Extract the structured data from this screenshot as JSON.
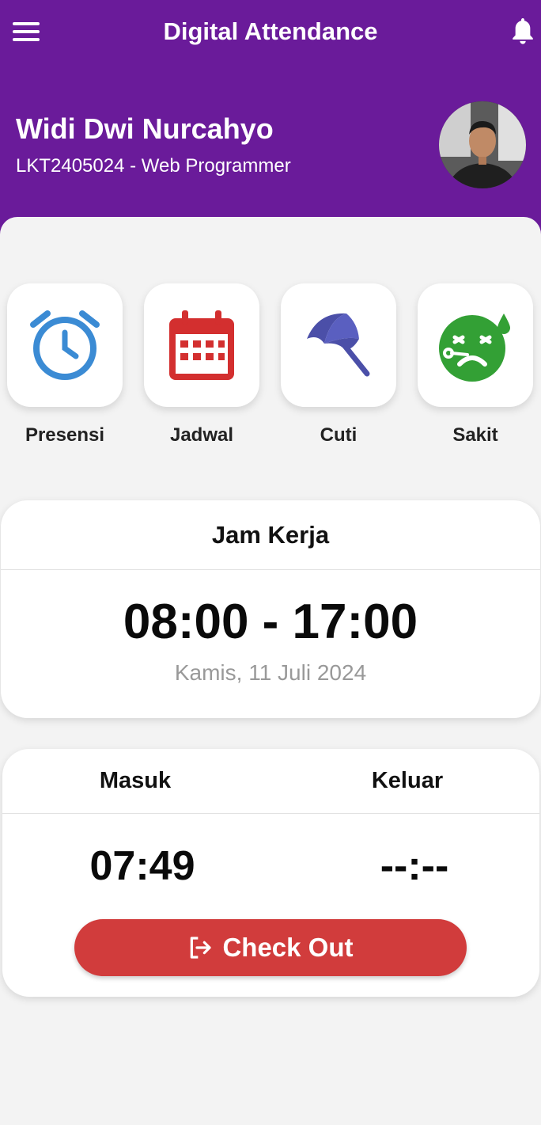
{
  "header": {
    "title": "Digital Attendance",
    "menu_icon": "hamburger-menu-icon",
    "notification_icon": "bell-icon",
    "background_color": "#6a1b9a"
  },
  "user": {
    "name": "Widi Dwi Nurcahyo",
    "subtitle": "LKT2405024 - Web Programmer"
  },
  "menu_tiles": [
    {
      "label": "Presensi",
      "icon": "alarm-clock-icon",
      "color": "#3b8bd4"
    },
    {
      "label": "Jadwal",
      "icon": "calendar-icon",
      "color": "#d32f2f"
    },
    {
      "label": "Cuti",
      "icon": "umbrella-icon",
      "color": "#4b4fa8"
    },
    {
      "label": "Sakit",
      "icon": "sick-face-icon",
      "color": "#33a035"
    }
  ],
  "work_hours": {
    "title": "Jam Kerja",
    "range": "08:00 - 17:00",
    "date": "Kamis, 11 Juli 2024"
  },
  "attendance": {
    "in_label": "Masuk",
    "out_label": "Keluar",
    "in_time": "07:49",
    "out_time": "--:--",
    "checkout_label": "Check Out",
    "checkout_icon": "logout-icon",
    "checkout_color": "#d13c3c"
  }
}
